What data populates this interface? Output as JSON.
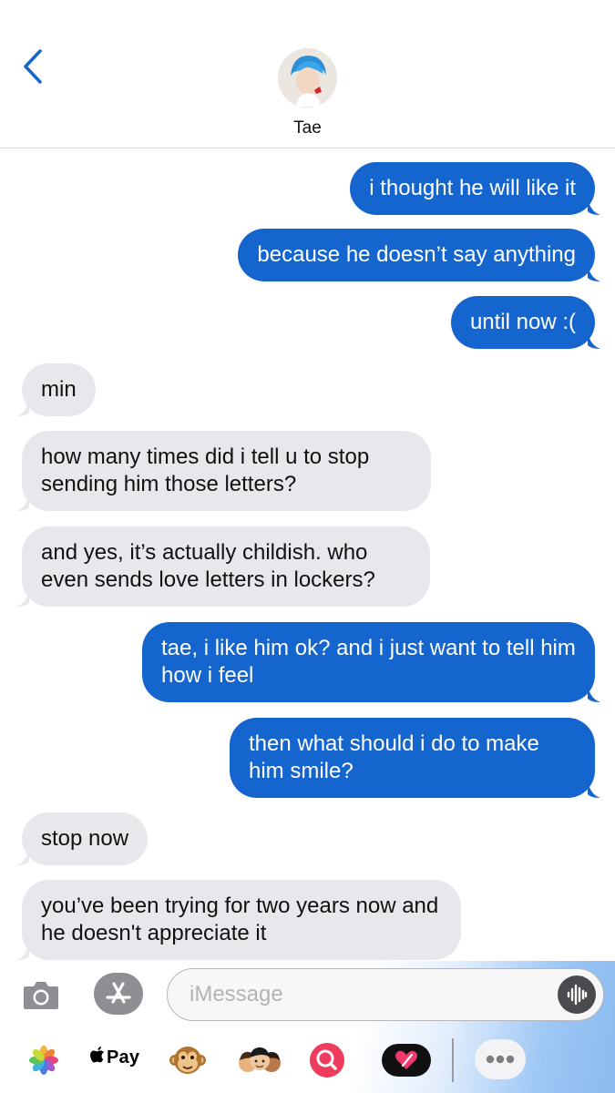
{
  "contact": {
    "name": "Tae"
  },
  "messages": [
    {
      "dir": "out",
      "text": "i thought he will like it"
    },
    {
      "dir": "out",
      "text": "because he doesn’t say anything"
    },
    {
      "dir": "out",
      "text": "until now :("
    },
    {
      "dir": "in",
      "text": "min"
    },
    {
      "dir": "in",
      "text": "how many times did i tell u to stop sending him those letters?"
    },
    {
      "dir": "in",
      "text": "and yes, it’s actually childish. who even sends love letters in lockers?"
    },
    {
      "dir": "out",
      "text": "tae, i like him ok? and i just want to tell him how i feel"
    },
    {
      "dir": "out",
      "text": "then what should i do to make him smile?"
    },
    {
      "dir": "in",
      "text": "stop now"
    },
    {
      "dir": "in",
      "text": "you’ve been trying for two years now and he doesn't appreciate it"
    }
  ],
  "composer": {
    "placeholder": "iMessage",
    "value": ""
  },
  "apps": {
    "applepay_label": "Pay",
    "icons": [
      "photos-icon",
      "apple-pay-icon",
      "monkey-animoji-icon",
      "memoji-icon",
      "search-images-icon",
      "digital-touch-icon",
      "more-apps-icon"
    ]
  },
  "colors": {
    "outgoing": "#1565cf",
    "incoming": "#e8e8ec",
    "accent": "#1565cf"
  }
}
